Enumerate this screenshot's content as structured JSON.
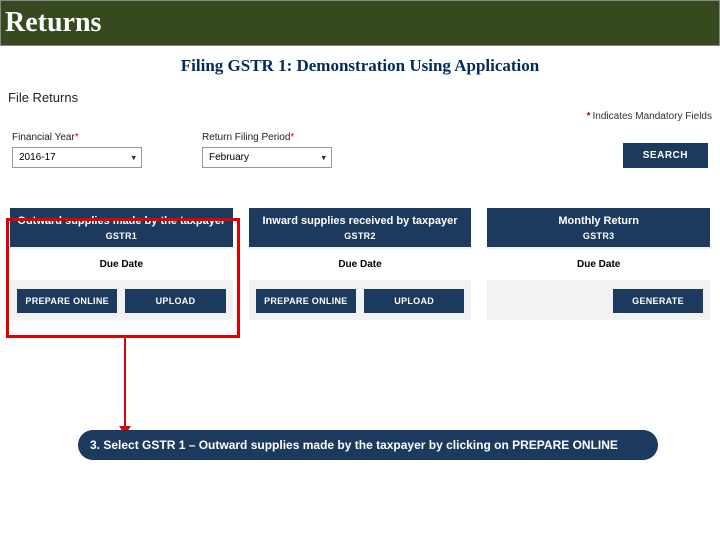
{
  "header": "Returns",
  "subtitle": "Filing GSTR 1: Demonstration Using Application",
  "page_title": "File Returns",
  "mandatory_note": "Indicates Mandatory Fields",
  "filters": {
    "financial_year": {
      "label": "Financial Year",
      "value": "2016-17"
    },
    "period": {
      "label": "Return Filing Period",
      "value": "February"
    },
    "search_label": "SEARCH"
  },
  "cards": [
    {
      "title": "Outward supplies made by the taxpayer",
      "code": "GSTR1",
      "due": "Due Date",
      "actions": [
        "PREPARE ONLINE",
        "UPLOAD"
      ]
    },
    {
      "title": "Inward supplies received by taxpayer",
      "code": "GSTR2",
      "due": "Due Date",
      "actions": [
        "PREPARE ONLINE",
        "UPLOAD"
      ]
    },
    {
      "title": "Monthly Return",
      "code": "GSTR3",
      "due": "Due Date",
      "actions": [
        "GENERATE"
      ]
    }
  ],
  "callout": "3. Select GSTR 1 – Outward supplies made by the taxpayer by clicking on PREPARE ONLINE"
}
